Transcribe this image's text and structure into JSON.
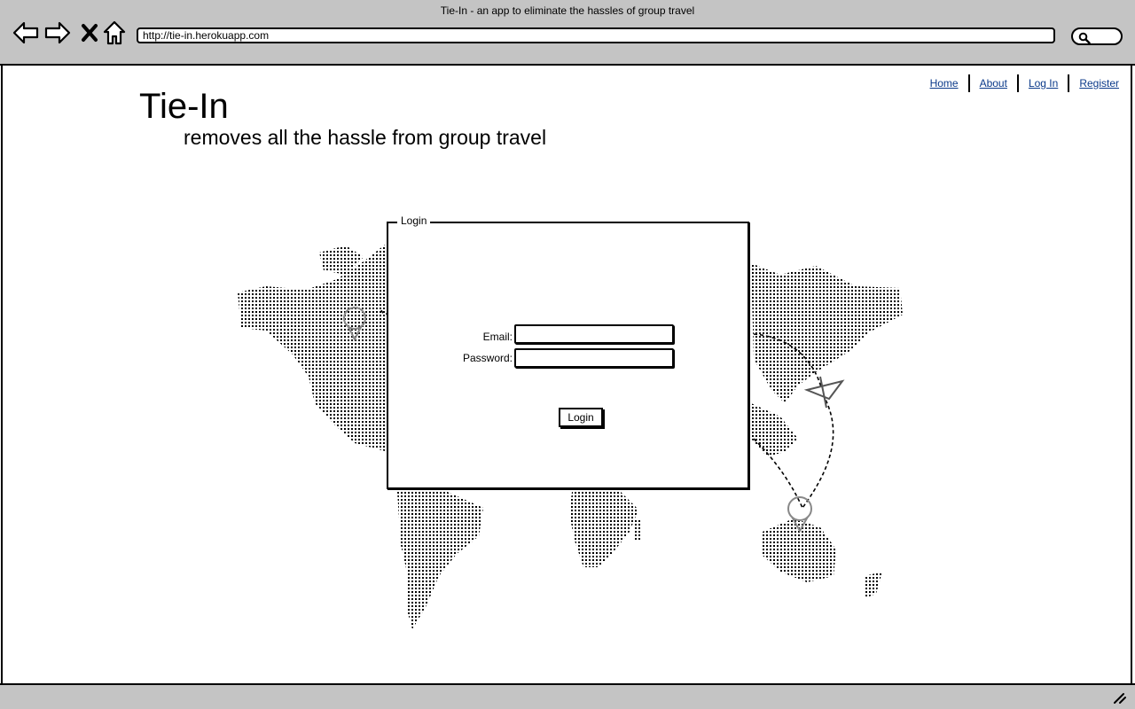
{
  "browser": {
    "window_title": "Tie-In - an app to eliminate the hassles of group travel",
    "url": "http://tie-in.herokuapp.com"
  },
  "topnav": {
    "items": [
      "Home",
      "About",
      "Log In",
      "Register"
    ]
  },
  "header": {
    "title": "Tie-In",
    "tagline": "removes all the hassle from group travel"
  },
  "login": {
    "legend": "Login",
    "email_label": "Email:",
    "password_label": "Password:",
    "button_label": "Login"
  }
}
